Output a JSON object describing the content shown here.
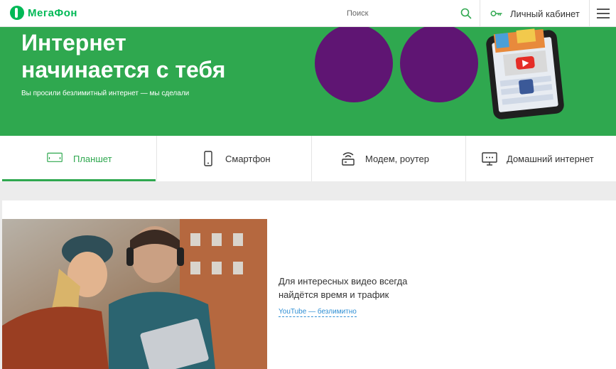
{
  "header": {
    "logo_text": "МегаФон",
    "search_placeholder": "Поиск",
    "cabinet_label": "Личный кабинет"
  },
  "hero": {
    "title": "Интернет\nначинается с тебя",
    "subtitle": "Вы просили безлимитный интернет — мы сделали"
  },
  "tabs": [
    {
      "label": "Планшет",
      "icon": "tablet-icon",
      "active": true
    },
    {
      "label": "Смартфон",
      "icon": "smartphone-icon",
      "active": false
    },
    {
      "label": "Модем, роутер",
      "icon": "router-icon",
      "active": false
    },
    {
      "label": "Домашний интернет",
      "icon": "monitor-icon",
      "active": false
    }
  ],
  "promo": {
    "text": "Для интересных видео всегда найдётся время и трафик",
    "link": "YouTube — безлимитно"
  },
  "colors": {
    "brand_green": "#2fa84f",
    "brand_purple": "#5f1573",
    "link_blue": "#2f8fd4"
  }
}
